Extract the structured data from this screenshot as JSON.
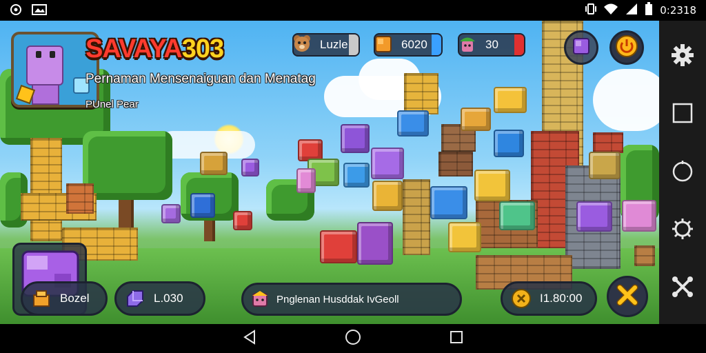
{
  "status_bar": {
    "left_icons": [
      "notification-icon",
      "gallery-icon"
    ],
    "right_icons": [
      "vibrate-icon",
      "wifi-icon",
      "signal-icon",
      "battery-icon"
    ],
    "time": "0:2318"
  },
  "hud": {
    "title_main": "SAVAYA",
    "title_num": "303",
    "subtitle": "Pernaman Mensenaiguan dan Menatag",
    "player_name": "PUnel Pear",
    "resources": [
      {
        "icon": "bear-icon",
        "value": "Luzle",
        "endcap_color": "#c9c9c9"
      },
      {
        "icon": "orange-cube-icon",
        "value": "6020",
        "endcap_color": "#3aa0ff"
      },
      {
        "icon": "green-cap-icon",
        "value": "30",
        "endcap_color": "#e03030"
      }
    ],
    "top_buttons": [
      "purple-cube-icon",
      "power-icon"
    ]
  },
  "bottom": {
    "big_cube_icon": "purple-cube-icon",
    "items": [
      {
        "icon": "chest-icon",
        "value": "Bozel"
      },
      {
        "icon": "gem-icon",
        "value": "L.030"
      },
      {
        "icon": "character-icon",
        "value": "Pnglenan Husddak IvGeoll"
      },
      {
        "icon": "coin-icon",
        "value": "I1.80:00"
      }
    ],
    "close_icon": "close-x-icon"
  },
  "sidebar": [
    "gear-icon",
    "square-icon",
    "circle-icon",
    "gear-icon",
    "crossed-tools-icon"
  ],
  "navbar": [
    "back-triangle-icon",
    "home-circle-icon",
    "recents-square-icon"
  ],
  "colors": {
    "title_red": "#ff3b2e",
    "title_yellow": "#ffd21f",
    "hud_panel": "#283246",
    "close_yellow": "#ffc21a"
  }
}
